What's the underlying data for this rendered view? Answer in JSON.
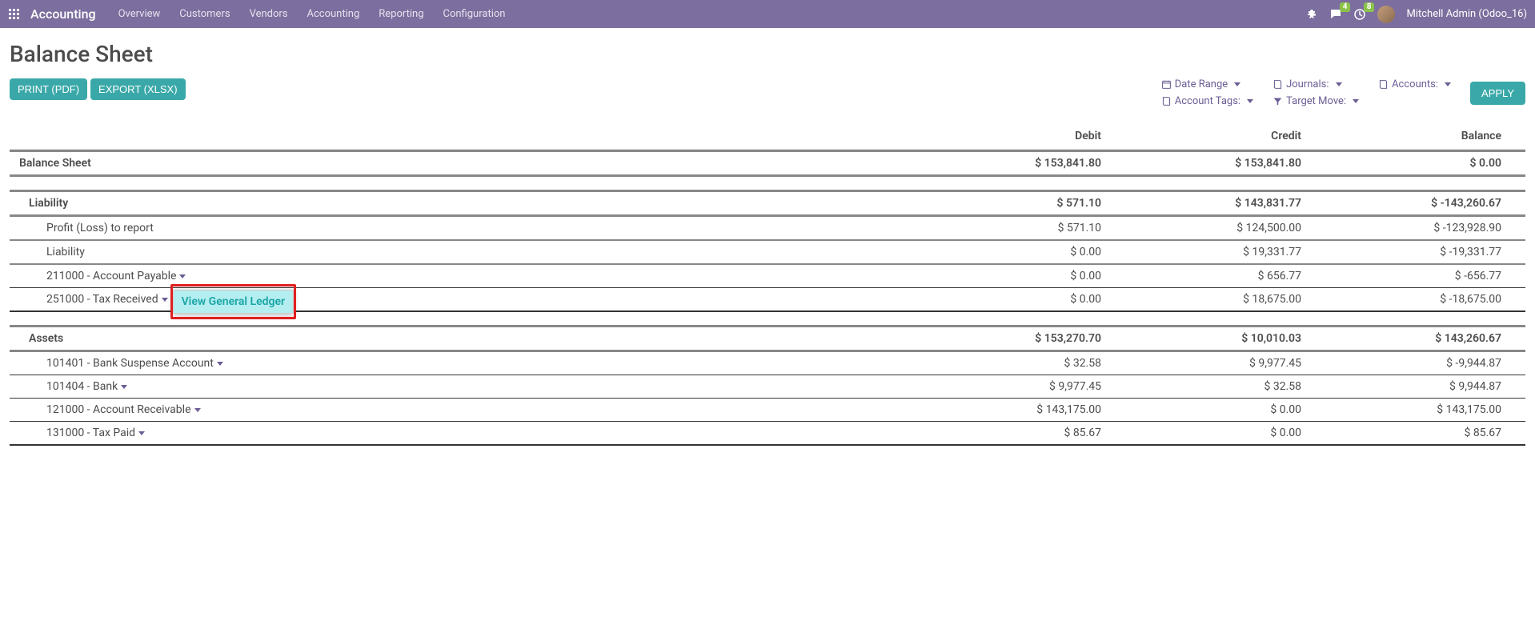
{
  "nav": {
    "brand": "Accounting",
    "links": [
      "Overview",
      "Customers",
      "Vendors",
      "Accounting",
      "Reporting",
      "Configuration"
    ],
    "msg_badge": "4",
    "activity_badge": "8",
    "user": "Mitchell Admin (Odoo_16)"
  },
  "page_title": "Balance Sheet",
  "buttons": {
    "print": "PRINT (PDF)",
    "export": "EXPORT (XLSX)",
    "apply": "APPLY"
  },
  "filters": {
    "date_range": "Date Range",
    "journals": "Journals:",
    "accounts": "Accounts:",
    "account_tags": "Account Tags:",
    "target_move": "Target Move:"
  },
  "columns": {
    "name": "",
    "debit": "Debit",
    "credit": "Credit",
    "balance": "Balance"
  },
  "popup": {
    "view_general_ledger": "View General Ledger"
  },
  "rows": [
    {
      "level": "l0",
      "name": "Balance Sheet",
      "debit": "$ 153,841.80",
      "credit": "$ 153,841.80",
      "balance": "$ 0.00"
    },
    {
      "level": "l1",
      "name": "Liability",
      "debit": "$ 571.10",
      "credit": "$ 143,831.77",
      "balance": "$ -143,260.67"
    },
    {
      "level": "l2",
      "name": "Profit (Loss) to report",
      "debit": "$ 571.10",
      "credit": "$ 124,500.00",
      "balance": "$ -123,928.90"
    },
    {
      "level": "l2",
      "name": "Liability",
      "debit": "$ 0.00",
      "credit": "$ 19,331.77",
      "balance": "$ -19,331.77"
    },
    {
      "level": "l3",
      "name": "211000 - Account Payable",
      "debit": "$ 0.00",
      "credit": "$ 656.77",
      "balance": "$ -656.77",
      "caret": true
    },
    {
      "level": "l3",
      "name": "251000 - Tax Received",
      "debit": "$ 0.00",
      "credit": "$ 18,675.00",
      "balance": "$ -18,675.00",
      "caret": true,
      "popup": true,
      "last_thick": true
    },
    {
      "level": "l1",
      "name": "Assets",
      "debit": "$ 153,270.70",
      "credit": "$ 10,010.03",
      "balance": "$ 143,260.67"
    },
    {
      "level": "l3",
      "name": "101401 - Bank Suspense Account",
      "debit": "$ 32.58",
      "credit": "$ 9,977.45",
      "balance": "$ -9,944.87",
      "caret": true
    },
    {
      "level": "l3",
      "name": "101404 - Bank",
      "debit": "$ 9,977.45",
      "credit": "$ 32.58",
      "balance": "$ 9,944.87",
      "caret": true
    },
    {
      "level": "l3",
      "name": "121000 - Account Receivable",
      "debit": "$ 143,175.00",
      "credit": "$ 0.00",
      "balance": "$ 143,175.00",
      "caret": true
    },
    {
      "level": "l3",
      "name": "131000 - Tax Paid",
      "debit": "$ 85.67",
      "credit": "$ 0.00",
      "balance": "$ 85.67",
      "caret": true,
      "last_thick": true
    }
  ]
}
